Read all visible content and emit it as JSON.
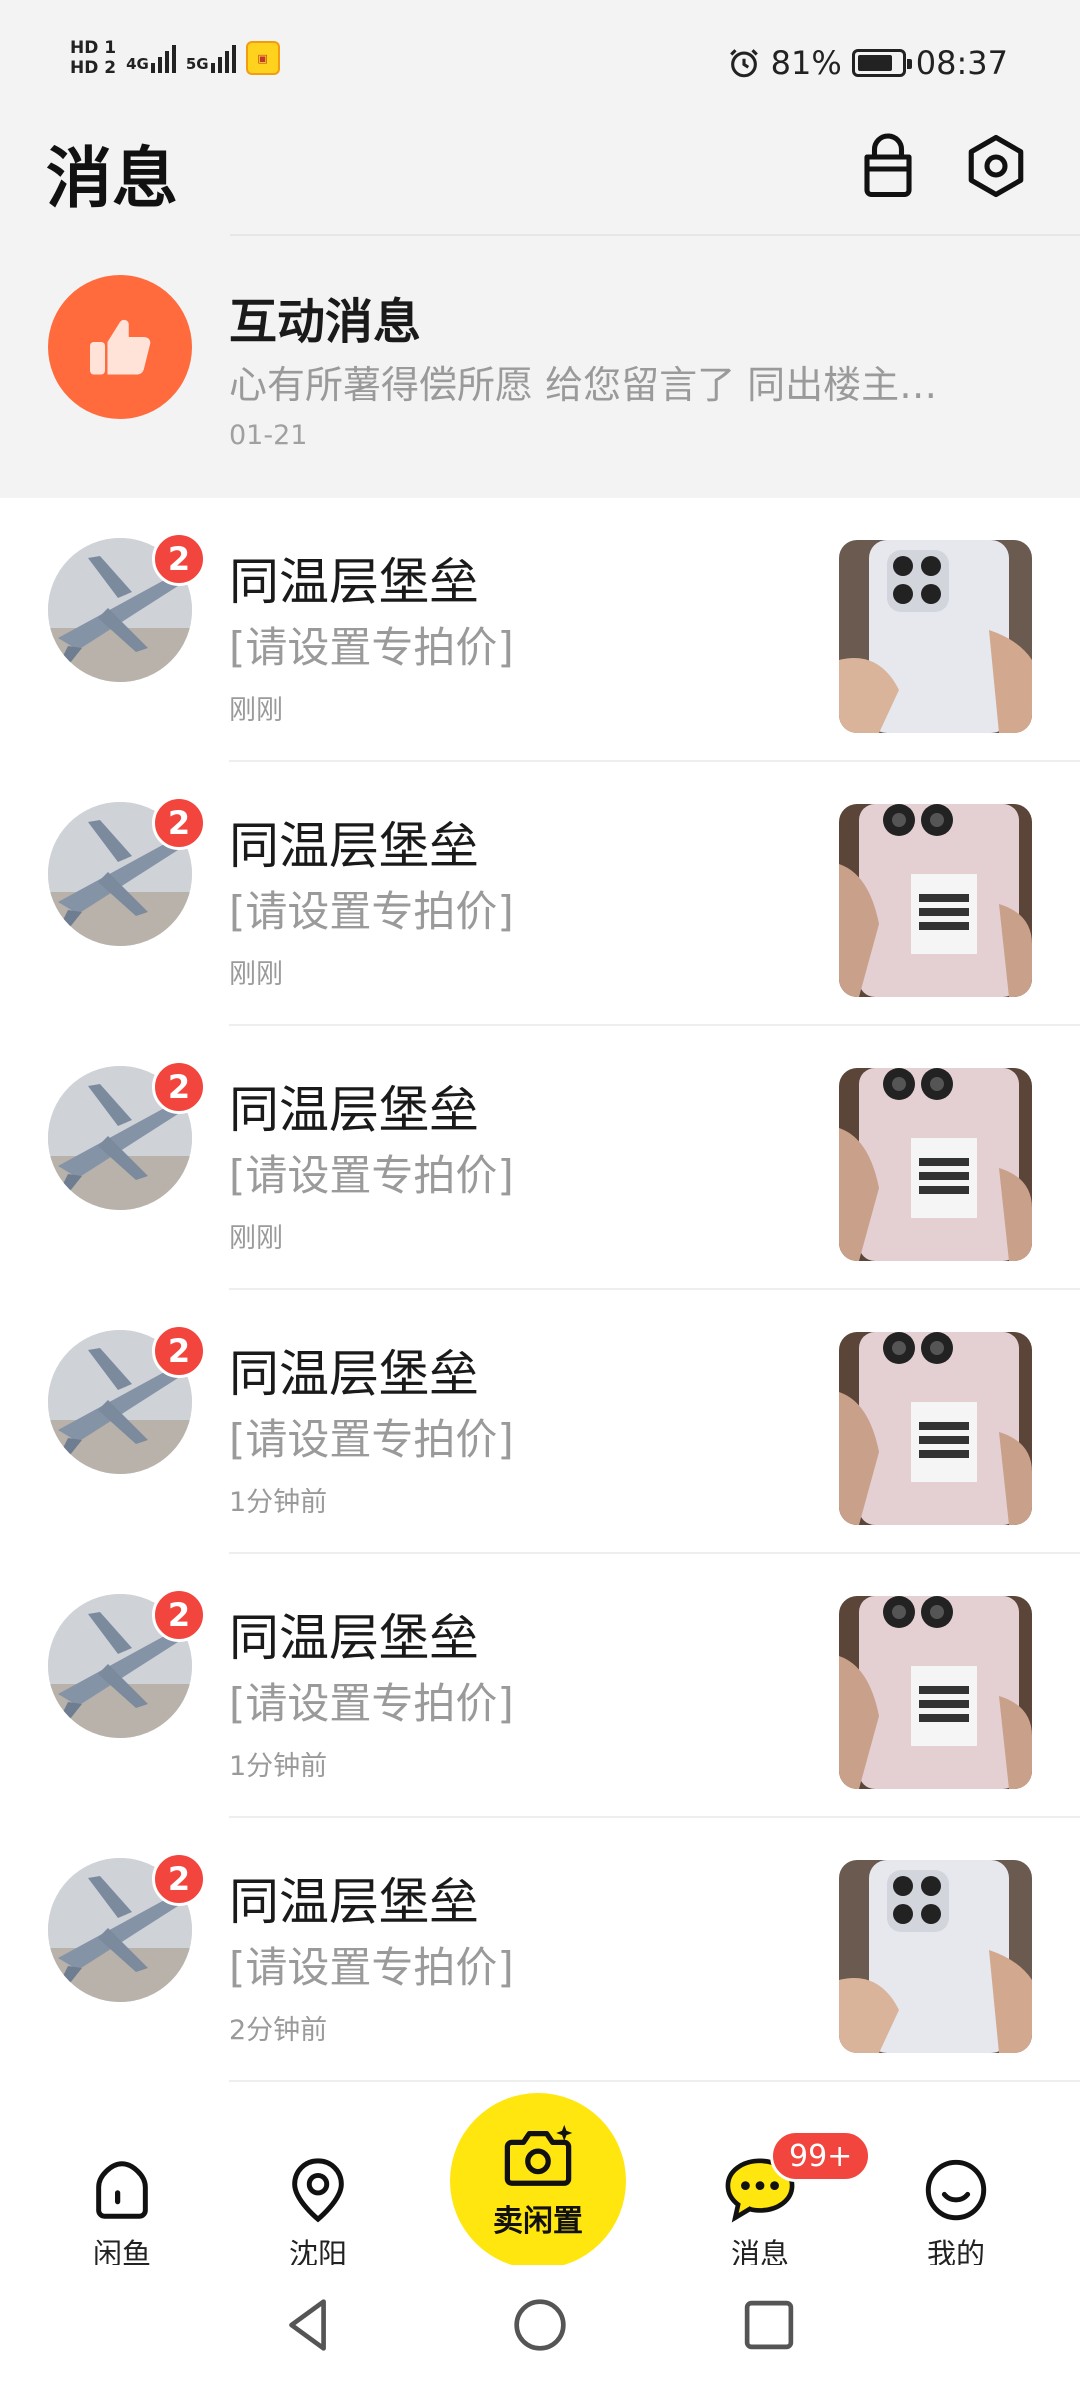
{
  "status_bar": {
    "hd1": "HD 1",
    "hd2": "HD 2",
    "net1": "4G",
    "net2": "5G",
    "battery_percent": "81%",
    "time": "08:37",
    "battery_level": 0.81
  },
  "header": {
    "title": "消息",
    "icons": [
      "bag-icon",
      "settings-icon"
    ]
  },
  "interaction": {
    "title": "互动消息",
    "preview": "心有所薯得偿所愿 给您留言了 同出楼主…",
    "date": "01-21",
    "accent": "#ff6b3d"
  },
  "chats": [
    {
      "name": "同温层堡垒",
      "message": "[请设置专拍价]",
      "time": "刚刚",
      "unread": "2",
      "product": "white"
    },
    {
      "name": "同温层堡垒",
      "message": "[请设置专拍价]",
      "time": "刚刚",
      "unread": "2",
      "product": "pink"
    },
    {
      "name": "同温层堡垒",
      "message": "[请设置专拍价]",
      "time": "刚刚",
      "unread": "2",
      "product": "pink"
    },
    {
      "name": "同温层堡垒",
      "message": "[请设置专拍价]",
      "time": "1分钟前",
      "unread": "2",
      "product": "pink"
    },
    {
      "name": "同温层堡垒",
      "message": "[请设置专拍价]",
      "time": "1分钟前",
      "unread": "2",
      "product": "pink"
    },
    {
      "name": "同温层堡垒",
      "message": "[请设置专拍价]",
      "time": "2分钟前",
      "unread": "2",
      "product": "white"
    }
  ],
  "bottom_nav": {
    "home": "闲鱼",
    "city": "沈阳",
    "sell": "卖闲置",
    "messages": "消息",
    "messages_badge": "99+",
    "mine": "我的",
    "sell_color": "#ffe60f"
  }
}
